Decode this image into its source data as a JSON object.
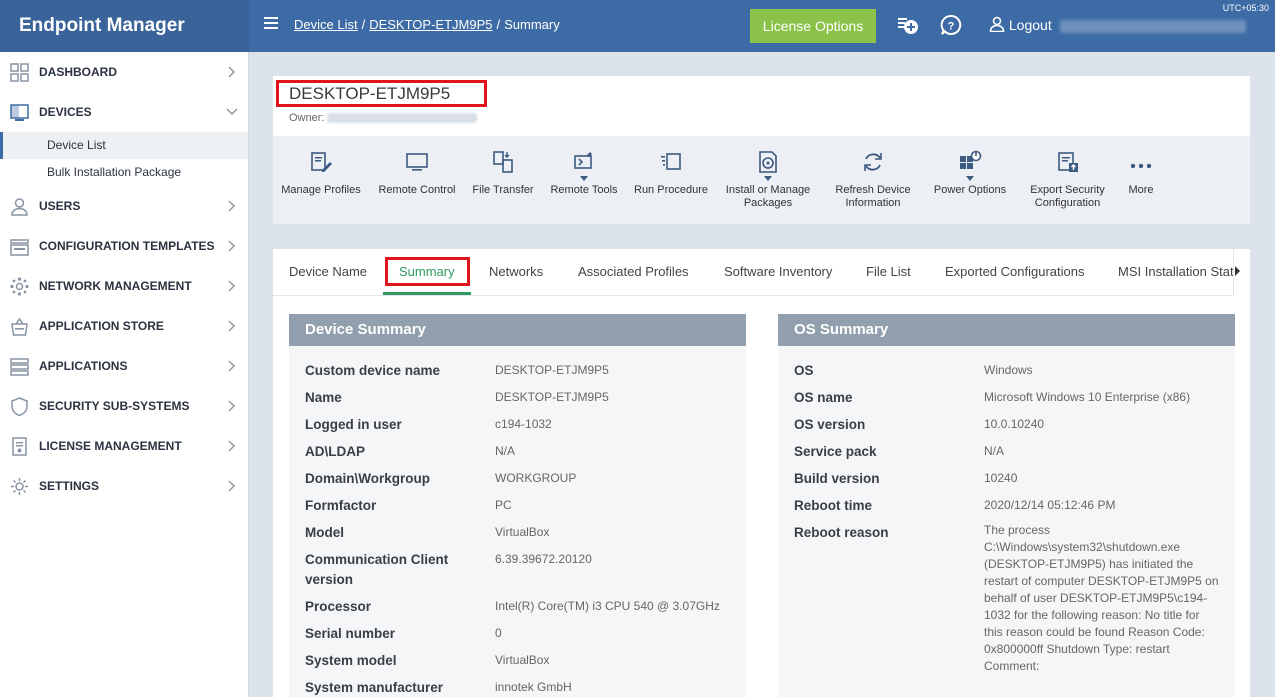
{
  "header": {
    "brand": "Endpoint Manager",
    "breadcrumb": {
      "item1": "Device List",
      "item2": "DESKTOP-ETJM9P5",
      "current": "Summary"
    },
    "license_button": "License Options",
    "logout_label": "Logout",
    "timezone": "UTC+05:30",
    "accent_color": "#3d6ba5",
    "license_color": "#8bc34a"
  },
  "sidebar": {
    "items": [
      {
        "label": "DASHBOARD",
        "icon": "dashboard-icon"
      },
      {
        "label": "DEVICES",
        "icon": "devices-icon"
      },
      {
        "label": "USERS",
        "icon": "users-icon"
      },
      {
        "label": "CONFIGURATION TEMPLATES",
        "icon": "templates-icon"
      },
      {
        "label": "NETWORK MANAGEMENT",
        "icon": "network-icon"
      },
      {
        "label": "APPLICATION STORE",
        "icon": "store-icon"
      },
      {
        "label": "APPLICATIONS",
        "icon": "applications-icon"
      },
      {
        "label": "SECURITY SUB-SYSTEMS",
        "icon": "shield-icon"
      },
      {
        "label": "LICENSE MANAGEMENT",
        "icon": "license-icon"
      },
      {
        "label": "SETTINGS",
        "icon": "gear-icon"
      }
    ],
    "sub_items": [
      "Device List",
      "Bulk Installation Package"
    ]
  },
  "device": {
    "title": "DESKTOP-ETJM9P5",
    "owner_label": "Owner:"
  },
  "toolbar": {
    "items": [
      {
        "label": "Manage Profiles",
        "icon": "profile-edit-icon"
      },
      {
        "label": "Remote Control",
        "icon": "monitor-icon"
      },
      {
        "label": "File Transfer",
        "icon": "file-transfer-icon"
      },
      {
        "label": "Remote Tools",
        "icon": "remote-tools-icon"
      },
      {
        "label": "Run Procedure",
        "icon": "run-procedure-icon"
      },
      {
        "label": "Install or Manage Packages",
        "icon": "package-icon"
      },
      {
        "label": "Refresh Device Information",
        "icon": "refresh-icon"
      },
      {
        "label": "Power Options",
        "icon": "power-icon"
      },
      {
        "label": "Export Security Configuration",
        "icon": "export-icon"
      },
      {
        "label": "More",
        "icon": "more-icon"
      }
    ]
  },
  "tabs": [
    "Device Name",
    "Summary",
    "Networks",
    "Associated Profiles",
    "Software Inventory",
    "File List",
    "Exported Configurations",
    "MSI Installation Stat"
  ],
  "device_summary": {
    "title": "Device Summary",
    "rows": [
      {
        "k": "Custom device name",
        "v": "DESKTOP-ETJM9P5"
      },
      {
        "k": "Name",
        "v": "DESKTOP-ETJM9P5"
      },
      {
        "k": "Logged in user",
        "v": "c194-1032"
      },
      {
        "k": "AD\\LDAP",
        "v": "N/A"
      },
      {
        "k": "Domain\\Workgroup",
        "v": "WORKGROUP"
      },
      {
        "k": "Formfactor",
        "v": "PC"
      },
      {
        "k": "Model",
        "v": "VirtualBox"
      },
      {
        "k": "Communication Client",
        "k2": "version",
        "v": "6.39.39672.20120"
      },
      {
        "k": "Processor",
        "v": "Intel(R) Core(TM) i3 CPU 540 @ 3.07GHz"
      },
      {
        "k": "Serial number",
        "v": "0"
      },
      {
        "k": "System model",
        "v": "VirtualBox"
      },
      {
        "k": "System manufacturer",
        "v": "innotek GmbH"
      }
    ]
  },
  "os_summary": {
    "title": "OS Summary",
    "rows": [
      {
        "k": "OS",
        "v": "Windows"
      },
      {
        "k": "OS name",
        "v": "Microsoft Windows 10 Enterprise (x86)"
      },
      {
        "k": "OS version",
        "v": "10.0.10240"
      },
      {
        "k": "Service pack",
        "v": "N/A"
      },
      {
        "k": "Build version",
        "v": "10240"
      },
      {
        "k": "Reboot time",
        "v": "2020/12/14 05:12:46 PM"
      },
      {
        "k": "Reboot reason",
        "lines": [
          "The process",
          "C:\\Windows\\system32\\shutdown.exe",
          "(DESKTOP-ETJM9P5) has initiated the",
          "restart of computer DESKTOP-ETJM9P5 on",
          "behalf of user DESKTOP-ETJM9P5\\c194-",
          "1032 for the following reason: No title for",
          "this reason could be found Reason Code:",
          "0x800000ff Shutdown Type: restart",
          "Comment:"
        ]
      }
    ]
  }
}
